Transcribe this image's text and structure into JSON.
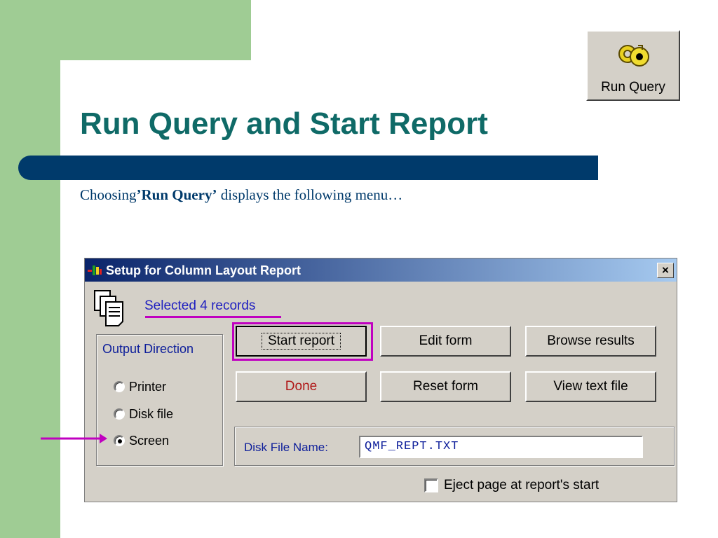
{
  "slide": {
    "title": "Run Query and Start Report",
    "subtitle_prefix": "Choosing",
    "subtitle_bold": "’Run Query’",
    "subtitle_suffix": " displays the following menu…"
  },
  "toolbar_button": {
    "label": "Run Query",
    "icon": "key-icon"
  },
  "dialog": {
    "title": "Setup for Column Layout Report",
    "close_label": "×",
    "selected_records": "Selected 4 records",
    "output_direction": {
      "title": "Output Direction",
      "options": [
        "Printer",
        "Disk file",
        "Screen"
      ],
      "selected": "Screen"
    },
    "buttons": {
      "start_report": "Start report",
      "edit_form": "Edit form",
      "browse_results": "Browse results",
      "done": "Done",
      "reset_form": "Reset form",
      "view_text_file": "View text file"
    },
    "disk_file_label": "Disk File Name:",
    "disk_file_value": "QMF_REPT.TXT",
    "eject_label": "Eject page at report's start",
    "eject_checked": false
  },
  "colors": {
    "green_background": "#9fcc94",
    "title_teal": "#0f6a67",
    "navy_bar": "#003a6b",
    "highlight_magenta": "#c000c0"
  }
}
